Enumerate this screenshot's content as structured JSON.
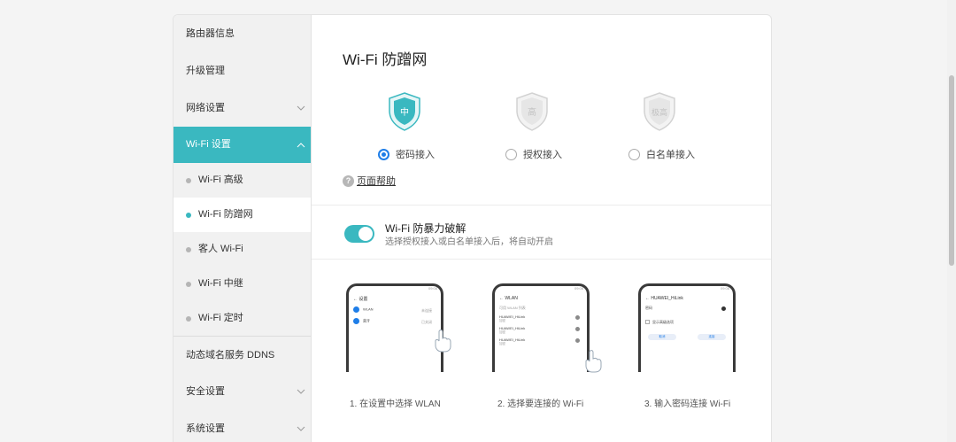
{
  "sidebar": {
    "items": [
      {
        "label": "路由器信息"
      },
      {
        "label": "升级管理"
      },
      {
        "label": "网络设置"
      },
      {
        "label": "Wi-Fi 设置"
      }
    ],
    "sub_items": [
      {
        "label": "Wi-Fi 高级"
      },
      {
        "label": "Wi-Fi 防蹭网"
      },
      {
        "label": "客人 Wi-Fi"
      },
      {
        "label": "Wi-Fi 中继"
      },
      {
        "label": "Wi-Fi 定时"
      }
    ],
    "bottom_items": [
      {
        "label": "动态域名服务 DDNS"
      },
      {
        "label": "安全设置"
      },
      {
        "label": "系统设置"
      }
    ]
  },
  "main": {
    "title": "Wi-Fi 防蹭网",
    "levels": [
      {
        "badge": "中",
        "label": "密码接入",
        "selected": true
      },
      {
        "badge": "高",
        "label": "授权接入",
        "selected": false
      },
      {
        "badge": "极高",
        "label": "白名单接入",
        "selected": false
      }
    ],
    "help_label": "页面帮助",
    "brute_force": {
      "title": "Wi-Fi 防暴力破解",
      "desc": "选择授权接入或白名单接入后，将自动开启",
      "enabled": true
    },
    "steps": [
      {
        "caption": "1. 在设置中选择 WLAN",
        "screen_title": "设置",
        "rows": [
          {
            "name": "WLAN",
            "value": "未连接"
          },
          {
            "name": "蓝牙",
            "value": "已关闭"
          }
        ]
      },
      {
        "caption": "2. 选择要连接的 Wi-Fi",
        "screen_title": "WLAN",
        "rows": [
          {
            "name": "可用 WLAN 列表",
            "value": ""
          },
          {
            "name": "HUAWEI_HiLink",
            "value": "加密"
          },
          {
            "name": "HUAWEI_HiLink",
            "value": "加密"
          },
          {
            "name": "HUAWEI_HiLink",
            "value": "加密"
          }
        ]
      },
      {
        "caption": "3. 输入密码连接 Wi-Fi",
        "screen_title": "HUAWEI_HiLink",
        "rows": [
          {
            "name": "密码",
            "value": ""
          },
          {
            "name": "显示高级选项",
            "value": ""
          }
        ],
        "buttons": [
          "取消",
          "连接"
        ]
      }
    ]
  },
  "colors": {
    "accent": "#3ab8c0",
    "radio": "#1f7ee8"
  }
}
